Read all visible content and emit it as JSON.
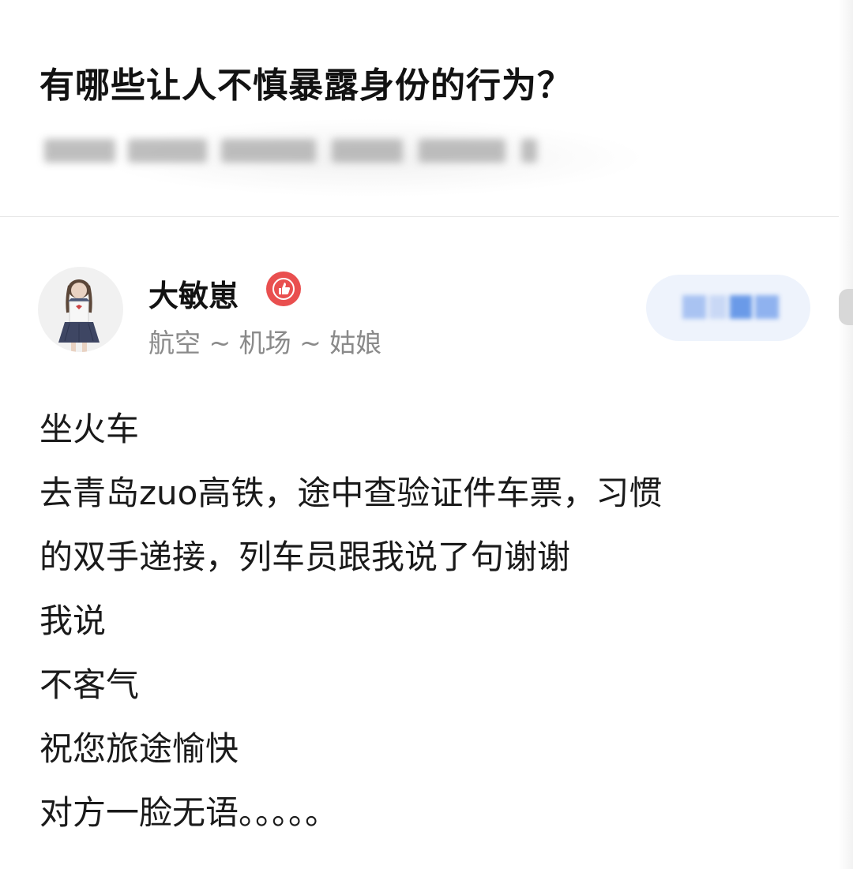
{
  "question": {
    "title": "有哪些让人不慎暴露身份的行为？"
  },
  "author": {
    "name": "大敏崽",
    "bio": "航空 ~ 机场 ~ 姑娘",
    "avatar_icon": "girl-avatar-icon",
    "badge_icon": "thumbs-up-badge-icon",
    "badge_color": "#e94f4f"
  },
  "answer": {
    "lines": [
      "坐火车",
      "去青岛zuo高铁，途中查验证件车票，习惯",
      "的双手递接，列车员跟我说了句谢谢",
      "我说",
      "不客气",
      "祝您旅途愉快",
      "对方一脸无语。。。。。"
    ]
  }
}
